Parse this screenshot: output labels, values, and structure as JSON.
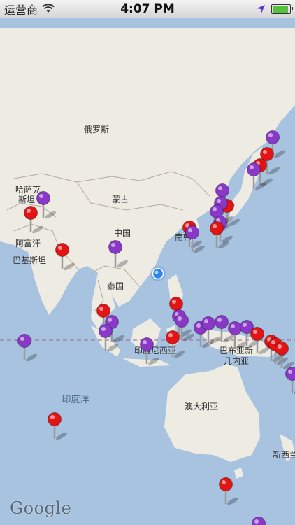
{
  "status": {
    "carrier": "运营商",
    "time": "4:07 PM",
    "battery_level": 1.0
  },
  "map": {
    "labels": {
      "russia": "俄罗斯",
      "kazakhstan_1": "哈萨克",
      "kazakhstan_2": "斯坦",
      "mongolia": "蒙古",
      "china": "中国",
      "afghanistan": "阿富汗",
      "pakistan": "巴基斯坦",
      "south_korea": "南韩",
      "thailand": "泰国",
      "indonesia": "印度尼西亚",
      "png_1": "巴布亚新",
      "png_2": "几内亚",
      "indian_ocean": "印度洋",
      "australia": "澳大利亚",
      "new_zealand": "新西兰"
    },
    "attribution": "Google",
    "pin_colors": {
      "red": "#e41414",
      "purple": "#8a38c8"
    }
  }
}
